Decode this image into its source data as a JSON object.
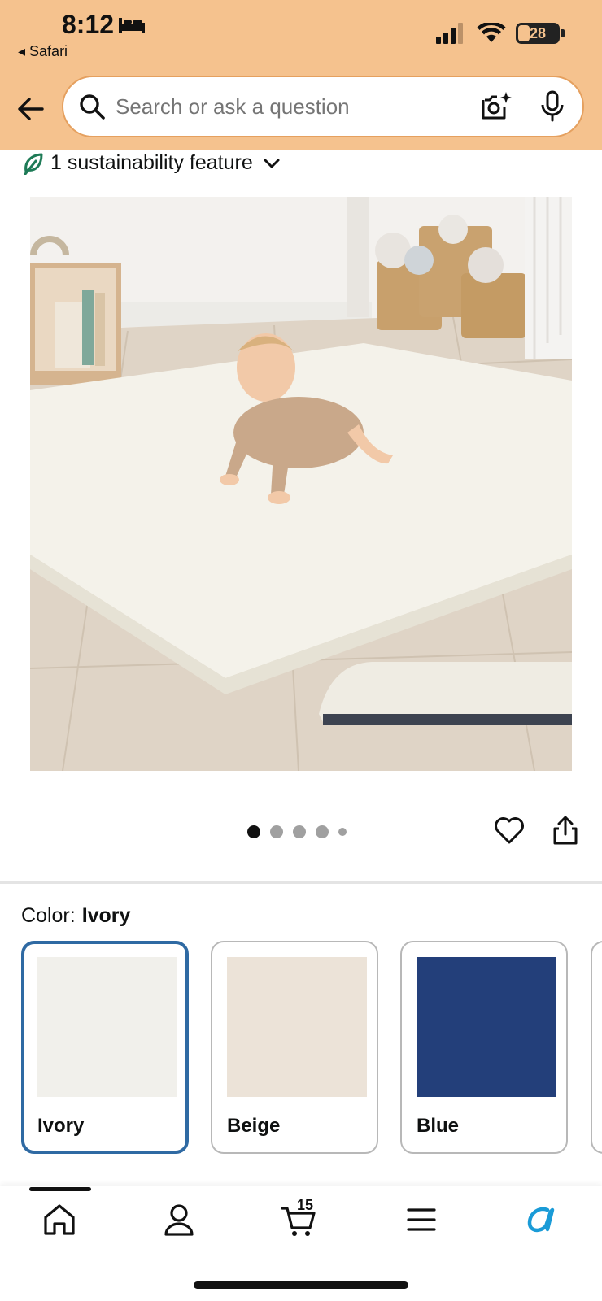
{
  "status_bar": {
    "time": "8:12",
    "back_to_app": "◂ Safari",
    "battery": "28"
  },
  "search": {
    "placeholder": "Search or ask a question"
  },
  "sustainability": {
    "label": "1 sustainability feature"
  },
  "carousel": {
    "total_dots": 5,
    "active_index": 0
  },
  "color": {
    "label": "Color:",
    "selected": "Ivory",
    "options": [
      {
        "name": "Ivory",
        "hex": "#f1f0eb"
      },
      {
        "name": "Beige",
        "hex": "#ece3d8"
      },
      {
        "name": "Blue",
        "hex": "#233f7a"
      }
    ]
  },
  "bottom_nav": {
    "cart_count": "15"
  },
  "colors": {
    "header": "#f5c28e",
    "selected_border": "#2f6aa3",
    "sustain_leaf": "#1e7b57",
    "alexa": "#1a9bd7"
  }
}
